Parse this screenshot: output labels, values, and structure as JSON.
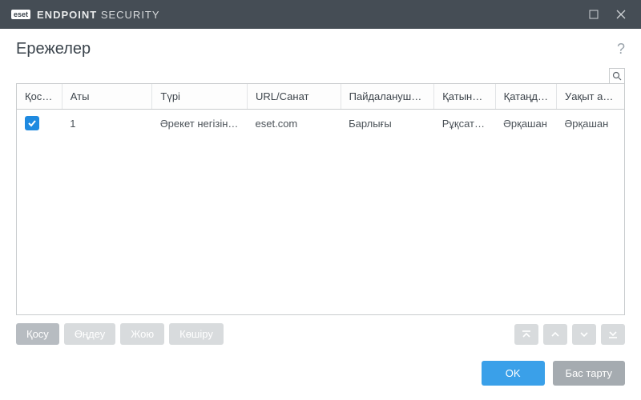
{
  "window": {
    "brand_badge": "eset",
    "brand_bold": "ENDPOINT",
    "brand_light": "SECURITY"
  },
  "dialog": {
    "title": "Ережелер"
  },
  "table": {
    "columns": {
      "enabled": "Қосыл...",
      "name": "Аты",
      "type": "Түрі",
      "url": "URL/Санат",
      "users": "Пайдаланушылар",
      "access": "Қатынасу ...",
      "severity": "Қатаңдық",
      "time": "Уақыт ара..."
    },
    "rows": [
      {
        "enabled": true,
        "name": "1",
        "type": "Әрекет негізінде ...",
        "url": "eset.com",
        "users": "Барлығы",
        "access": "Рұқсат ету",
        "severity": "Әрқашан",
        "time": "Әрқашан"
      }
    ]
  },
  "toolbar": {
    "add": "Қосу",
    "edit": "Өңдеу",
    "delete": "Жою",
    "copy": "Көшіру"
  },
  "footer": {
    "ok": "OK",
    "cancel": "Бас тарту"
  }
}
